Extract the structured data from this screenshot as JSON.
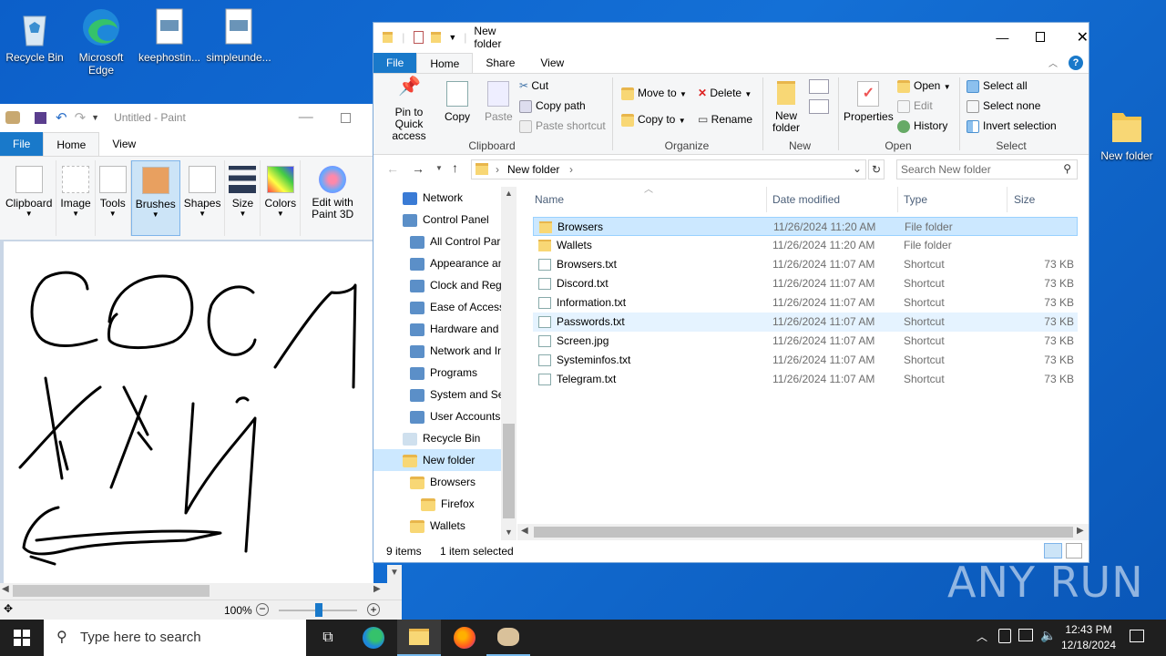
{
  "desktop": {
    "icons": [
      {
        "label": "Recycle Bin",
        "icon": "recycle-bin-icon"
      },
      {
        "label": "Microsoft Edge",
        "icon": "edge-icon"
      },
      {
        "label": "keephostin...",
        "icon": "file-icon"
      },
      {
        "label": "simpleunde...",
        "icon": "file-icon"
      },
      {
        "label": "New folder",
        "icon": "folder-icon"
      }
    ],
    "watermark": "ANY RUN"
  },
  "paint": {
    "title": "Untitled - Paint",
    "tabs": [
      "File",
      "Home",
      "View"
    ],
    "groups": [
      "Clipboard",
      "Image",
      "Tools",
      "Brushes",
      "Shapes",
      "Size",
      "Colors",
      "Edit with Paint 3D"
    ],
    "zoom": "100%"
  },
  "explorer": {
    "title": "New folder",
    "tabs": [
      "File",
      "Home",
      "Share",
      "View"
    ],
    "ribbon": {
      "pin": "Pin to Quick access",
      "copy": "Copy",
      "paste": "Paste",
      "cut": "Cut",
      "copy_path": "Copy path",
      "paste_shortcut": "Paste shortcut",
      "clipboard": "Clipboard",
      "move_to": "Move to",
      "copy_to": "Copy to",
      "delete": "Delete",
      "rename": "Rename",
      "organize": "Organize",
      "new_folder": "New folder",
      "new": "New",
      "properties": "Properties",
      "open": "Open",
      "edit": "Edit",
      "history": "History",
      "open_group": "Open",
      "select_all": "Select all",
      "select_none": "Select none",
      "invert_selection": "Invert selection",
      "select": "Select"
    },
    "address": "New folder",
    "search_placeholder": "Search New folder",
    "tree": [
      {
        "label": "Network",
        "indent": 1
      },
      {
        "label": "Control Panel",
        "indent": 1
      },
      {
        "label": "All Control Par",
        "indent": 2
      },
      {
        "label": "Appearance an",
        "indent": 2
      },
      {
        "label": "Clock and Regi",
        "indent": 2
      },
      {
        "label": "Ease of Access",
        "indent": 2
      },
      {
        "label": "Hardware and",
        "indent": 2
      },
      {
        "label": "Network and Ir",
        "indent": 2
      },
      {
        "label": "Programs",
        "indent": 2
      },
      {
        "label": "System and Sec",
        "indent": 2
      },
      {
        "label": "User Accounts",
        "indent": 2
      },
      {
        "label": "Recycle Bin",
        "indent": 1
      },
      {
        "label": "New folder",
        "indent": 1
      },
      {
        "label": "Browsers",
        "indent": 2
      },
      {
        "label": "Firefox",
        "indent": 3
      },
      {
        "label": "Wallets",
        "indent": 2
      }
    ],
    "columns": [
      "Name",
      "Date modified",
      "Type",
      "Size"
    ],
    "files": [
      {
        "name": "Browsers",
        "date": "11/26/2024 11:20 AM",
        "type": "File folder",
        "size": ""
      },
      {
        "name": "Wallets",
        "date": "11/26/2024 11:20 AM",
        "type": "File folder",
        "size": ""
      },
      {
        "name": "Browsers.txt",
        "date": "11/26/2024 11:07 AM",
        "type": "Shortcut",
        "size": "73 KB"
      },
      {
        "name": "Discord.txt",
        "date": "11/26/2024 11:07 AM",
        "type": "Shortcut",
        "size": "73 KB"
      },
      {
        "name": "Information.txt",
        "date": "11/26/2024 11:07 AM",
        "type": "Shortcut",
        "size": "73 KB"
      },
      {
        "name": "Passwords.txt",
        "date": "11/26/2024 11:07 AM",
        "type": "Shortcut",
        "size": "73 KB"
      },
      {
        "name": "Screen.jpg",
        "date": "11/26/2024 11:07 AM",
        "type": "Shortcut",
        "size": "73 KB"
      },
      {
        "name": "Systeminfos.txt",
        "date": "11/26/2024 11:07 AM",
        "type": "Shortcut",
        "size": "73 KB"
      },
      {
        "name": "Telegram.txt",
        "date": "11/26/2024 11:07 AM",
        "type": "Shortcut",
        "size": "73 KB"
      }
    ],
    "status_count": "9 items",
    "status_selected": "1 item selected"
  },
  "taskbar": {
    "search_placeholder": "Type here to search",
    "time": "12:43 PM",
    "date": "12/18/2024"
  }
}
